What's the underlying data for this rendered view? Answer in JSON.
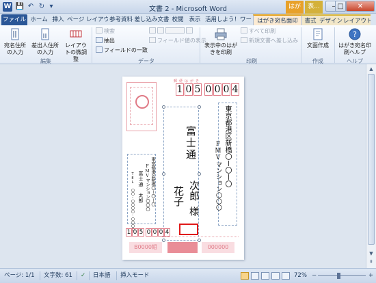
{
  "titlebar": {
    "app_icon": "W",
    "title": "文書 2 - Microsoft Word",
    "ctx_label_1": "はが",
    "ctx_label_2": "表...",
    "minimize": "–",
    "maximize": "□",
    "close": "✕"
  },
  "tabs": {
    "file": "ファイル",
    "home": "ホーム",
    "insert": "挿入",
    "page_layout": "ページ レイアウト",
    "references": "参考資料",
    "mailings": "差し込み文書",
    "review": "校閲",
    "view": "表示",
    "katsuyo": "活用しよう！ワー",
    "hagaki": "はがき宛名面印",
    "format": "書式",
    "design": "デザイン",
    "layout": "レイアウト"
  },
  "ribbon": {
    "edit": {
      "recipient_input": "宛名住所の入力",
      "sender_input": "差出人住所の入力",
      "layout_adjust": "レイアウトの微調整",
      "group_label": "編集"
    },
    "data": {
      "search": "検索",
      "extract": "抽出",
      "field_match": "フィールドの一致",
      "field_display": "フィールド値の表示",
      "group_label": "データ"
    },
    "print": {
      "show_print": "表示中のはがきを印刷",
      "print_all": "すべて印刷",
      "print_new": "新規文書へ差し込み",
      "group_label": "印刷"
    },
    "create": {
      "doc_create": "文面作成",
      "group_label": "作成"
    },
    "help": {
      "help_btn": "はがき宛名印刷ヘルプ",
      "group_label": "ヘルプ"
    }
  },
  "postcard": {
    "postal_label": "郵便はがき",
    "postal_code": [
      "1",
      "0",
      "5",
      "0",
      "0",
      "0",
      "4"
    ],
    "recipient_address_1": "東京都港区新橋〇ー〇ー〇",
    "recipient_address_2": "FMVマンション〇〇〇",
    "recipient_family": "富士通",
    "recipient_given_1": "次郎",
    "recipient_given_2": "花子",
    "honorific": "様",
    "sender_address": "東京都港区新橋〇ー〇ー〇",
    "sender_building": "FMVマンション〇〇〇",
    "sender_name": "富士通　太郎",
    "sender_tel": "TEL 〇〇-〇〇〇〇-〇〇〇〇",
    "sender_postal": [
      "1",
      "0",
      "5",
      "0",
      "0",
      "0",
      "4"
    ],
    "lottery_left": "B0000組",
    "lottery_right": "000000"
  },
  "statusbar": {
    "page": "ページ: 1/1",
    "word_count": "文字数: 61",
    "language": "日本語",
    "mode": "挿入モード",
    "zoom": "72%",
    "zoom_minus": "−",
    "zoom_plus": "+"
  },
  "colors": {
    "accent": "#2b5797",
    "postcard_red": "#e07a86",
    "highlight": "#e01818"
  }
}
